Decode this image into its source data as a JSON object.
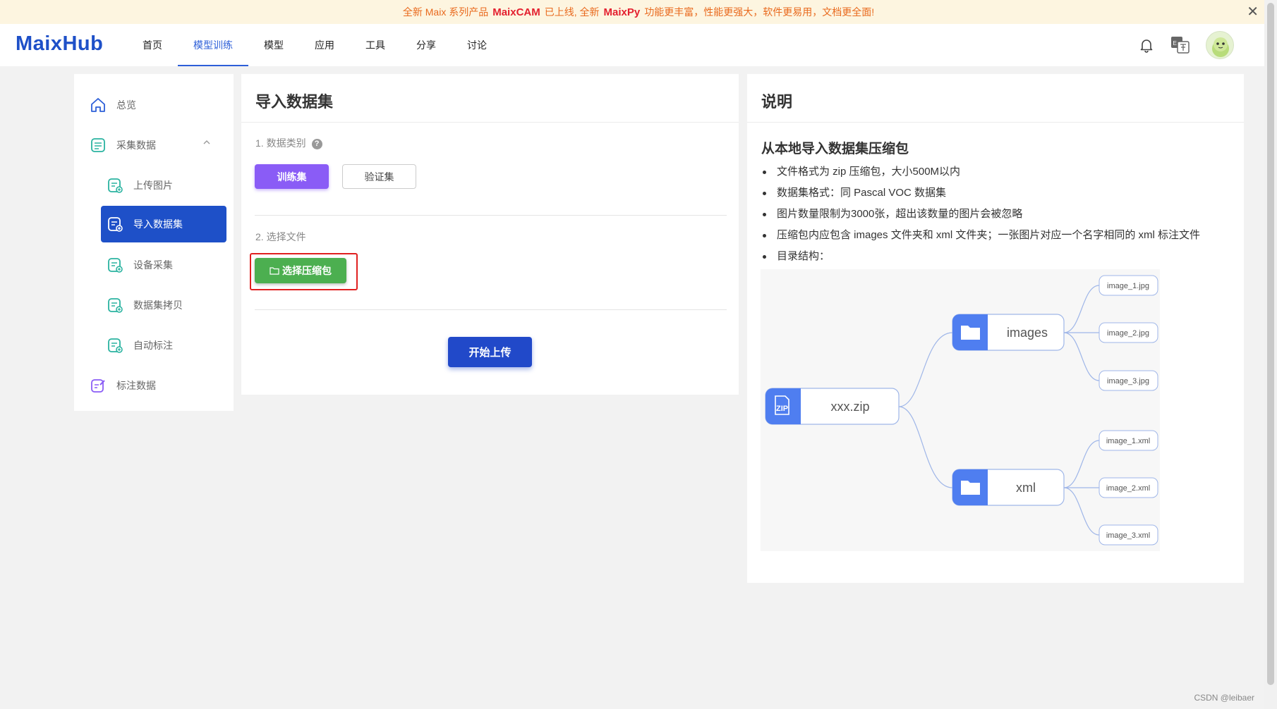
{
  "banner": {
    "part1": "全新 Maix 系列产品",
    "brand1": "MaixCAM",
    "part2": "已上线, 全新",
    "brand2": "MaixPy",
    "part3": "功能更丰富，性能更强大，软件更易用，文档更全面!",
    "close": "✕"
  },
  "nav": {
    "logo": "MaixHub",
    "items": [
      "首页",
      "模型训练",
      "模型",
      "应用",
      "工具",
      "分享",
      "讨论"
    ],
    "active_index": 1,
    "icons": [
      "bell-icon",
      "translate-icon",
      "avatar"
    ]
  },
  "sidebar": {
    "items": [
      {
        "label": "总览",
        "icon": "home-icon"
      },
      {
        "label": "采集数据",
        "icon": "collect-icon",
        "expanded": true
      },
      {
        "label": "上传图片",
        "icon": "upload-image-icon"
      },
      {
        "label": "导入数据集",
        "icon": "import-dataset-icon",
        "active": true
      },
      {
        "label": "设备采集",
        "icon": "device-collect-icon"
      },
      {
        "label": "数据集拷贝",
        "icon": "dataset-copy-icon"
      },
      {
        "label": "自动标注",
        "icon": "auto-annotate-icon"
      },
      {
        "label": "标注数据",
        "icon": "annotate-icon"
      }
    ]
  },
  "import": {
    "title": "导入数据集",
    "step1_label": "1. 数据类别",
    "help": "?",
    "train_button": "训练集",
    "val_button": "验证集",
    "step2_label": "2. 选择文件",
    "zip_button": "选择压缩包",
    "upload_button": "开始上传"
  },
  "info": {
    "title": "说明",
    "subtitle": "从本地导入数据集压缩包",
    "bullets": [
      "文件格式为 zip 压缩包，大小500M以内",
      "数据集格式：同 Pascal VOC 数据集",
      "图片数量限制为3000张，超出该数量的图片会被忽略",
      "压缩包内应包含 images 文件夹和 xml 文件夹；一张图片对应一个名字相同的 xml 标注文件",
      "目录结构："
    ],
    "diagram": {
      "root": "xxx.zip",
      "root_icon": "ZIP",
      "folders": [
        "images",
        "xml"
      ],
      "images_files": [
        "image_1.jpg",
        "image_2.jpg",
        "image_3.jpg"
      ],
      "xml_files": [
        "image_1.xml",
        "image_2.xml",
        "image_3.xml"
      ]
    }
  },
  "watermark": "CSDN @leibaer",
  "colors": {
    "brand": "#1e50c8",
    "purple": "#8a5cf6",
    "green": "#4caf50",
    "highlight": "#e02020",
    "banner_text": "#e96a1e"
  }
}
